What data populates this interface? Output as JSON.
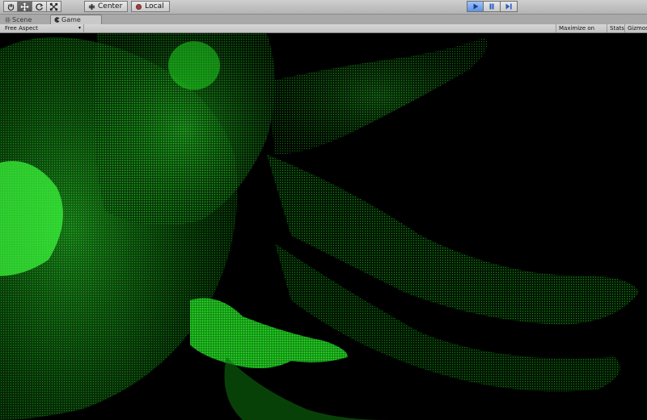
{
  "toolbar": {
    "tools": [
      {
        "name": "hand-tool",
        "icon": "hand-icon"
      },
      {
        "name": "move-tool",
        "icon": "move-icon"
      },
      {
        "name": "rotate-tool",
        "icon": "rotate-icon"
      },
      {
        "name": "scale-tool",
        "icon": "scale-icon"
      }
    ],
    "pivot_label": "Center",
    "space_label": "Local",
    "play_active": true,
    "accent_color": "#3f7fe0"
  },
  "tabs": {
    "scene_label": "Scene",
    "game_label": "Game"
  },
  "gamebar": {
    "aspect_label": "Free Aspect",
    "maximize_label": "Maximize on Play",
    "stats_label": "Stats",
    "gizmos_label": "Gizmos"
  },
  "viewport": {
    "background": "#000000",
    "pointcloud_color": "#22ff22"
  }
}
